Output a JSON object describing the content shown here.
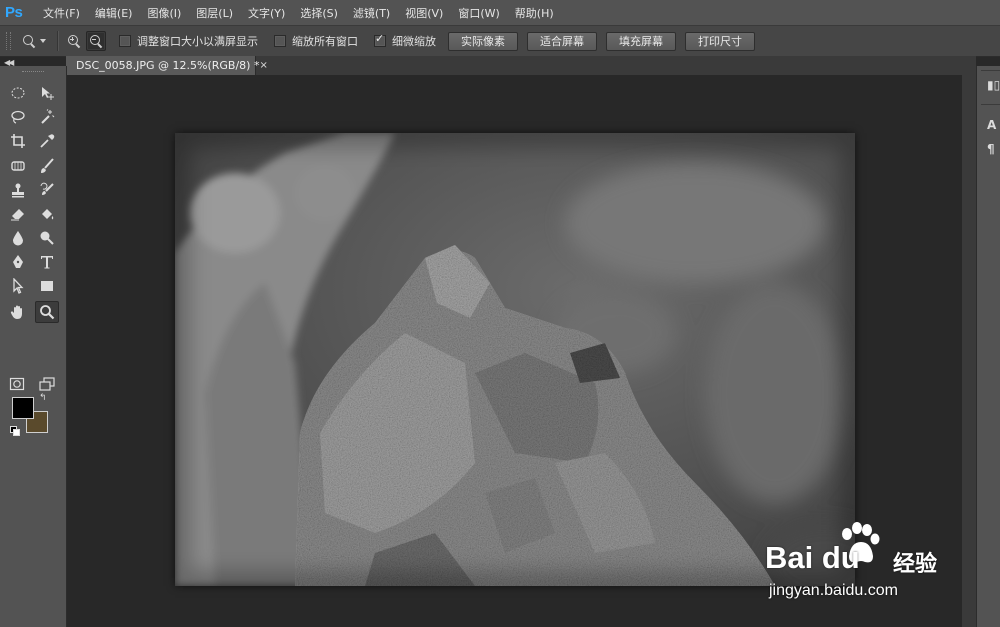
{
  "app": {
    "logo": "Ps"
  },
  "menu": [
    {
      "label": "文件(F)"
    },
    {
      "label": "编辑(E)"
    },
    {
      "label": "图像(I)"
    },
    {
      "label": "图层(L)"
    },
    {
      "label": "文字(Y)"
    },
    {
      "label": "选择(S)"
    },
    {
      "label": "滤镜(T)"
    },
    {
      "label": "视图(V)"
    },
    {
      "label": "窗口(W)"
    },
    {
      "label": "帮助(H)"
    }
  ],
  "options": {
    "active_tool_icon": "zoom-icon",
    "zoom_in_icon": "zoom-in-icon",
    "zoom_out_icon": "zoom-out-icon",
    "checkboxes": [
      {
        "label": "调整窗口大小以满屏显示",
        "checked": false
      },
      {
        "label": "缩放所有窗口",
        "checked": false
      },
      {
        "label": "细微缩放",
        "checked": true
      }
    ],
    "buttons": [
      "实际像素",
      "适合屏幕",
      "填充屏幕",
      "打印尺寸"
    ]
  },
  "document": {
    "tab_label": "DSC_0058.JPG @ 12.5%(RGB/8) *",
    "close_glyph": "×"
  },
  "toolbox": {
    "foreground_color": "#000000",
    "background_color": "#5a4a2c"
  },
  "watermark": {
    "brand": "Bai  du",
    "product": "经验",
    "url": "jingyan.baidu.com"
  }
}
